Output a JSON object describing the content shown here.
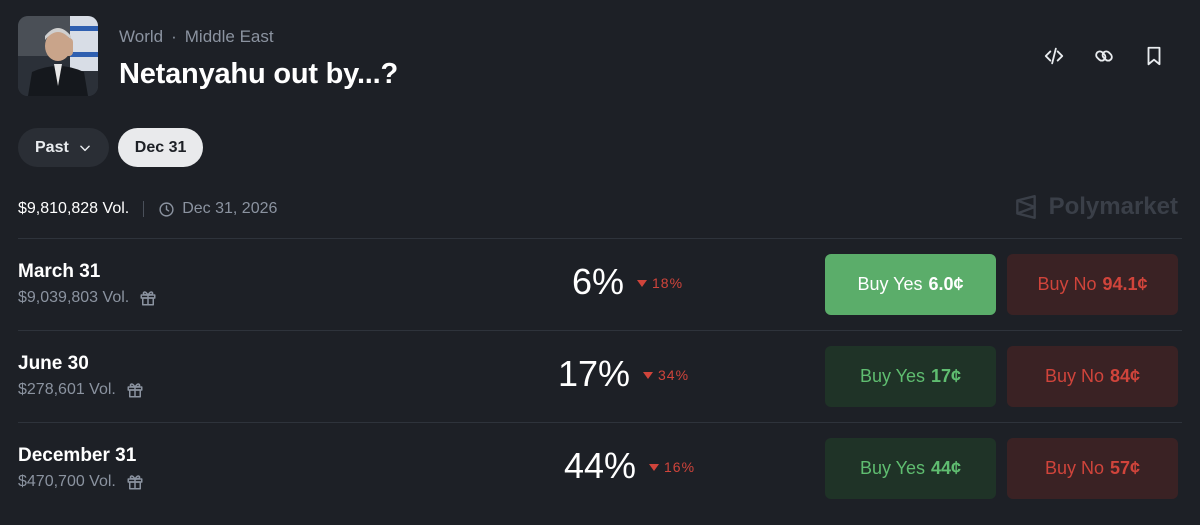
{
  "header": {
    "categories": [
      "World",
      "Middle East"
    ],
    "category_separator": "·",
    "title": "Netanyahu out by...?"
  },
  "header_icons": [
    "embed-code-icon",
    "link-icon",
    "bookmark-icon"
  ],
  "filters": {
    "past_label": "Past",
    "selected_date": "Dec 31"
  },
  "meta": {
    "volume": "$9,810,828 Vol.",
    "end_date": "Dec 31, 2026"
  },
  "brand": "Polymarket",
  "colors": {
    "background": "#1d2026",
    "yes_green": "#5bad6a",
    "no_red": "#d0443b",
    "muted_text": "#8b93a0"
  },
  "markets": [
    {
      "name": "March 31",
      "volume": "$9,039,803 Vol.",
      "probability": "6%",
      "change": "18%",
      "change_direction": "down",
      "yes_label": "Buy Yes",
      "yes_price": "6.0¢",
      "no_label": "Buy No",
      "no_price": "94.1¢"
    },
    {
      "name": "June 30",
      "volume": "$278,601 Vol.",
      "probability": "17%",
      "change": "34%",
      "change_direction": "down",
      "yes_label": "Buy Yes",
      "yes_price": "17¢",
      "no_label": "Buy No",
      "no_price": "84¢"
    },
    {
      "name": "December 31",
      "volume": "$470,700 Vol.",
      "probability": "44%",
      "change": "16%",
      "change_direction": "down",
      "yes_label": "Buy Yes",
      "yes_price": "44¢",
      "no_label": "Buy No",
      "no_price": "57¢"
    }
  ]
}
